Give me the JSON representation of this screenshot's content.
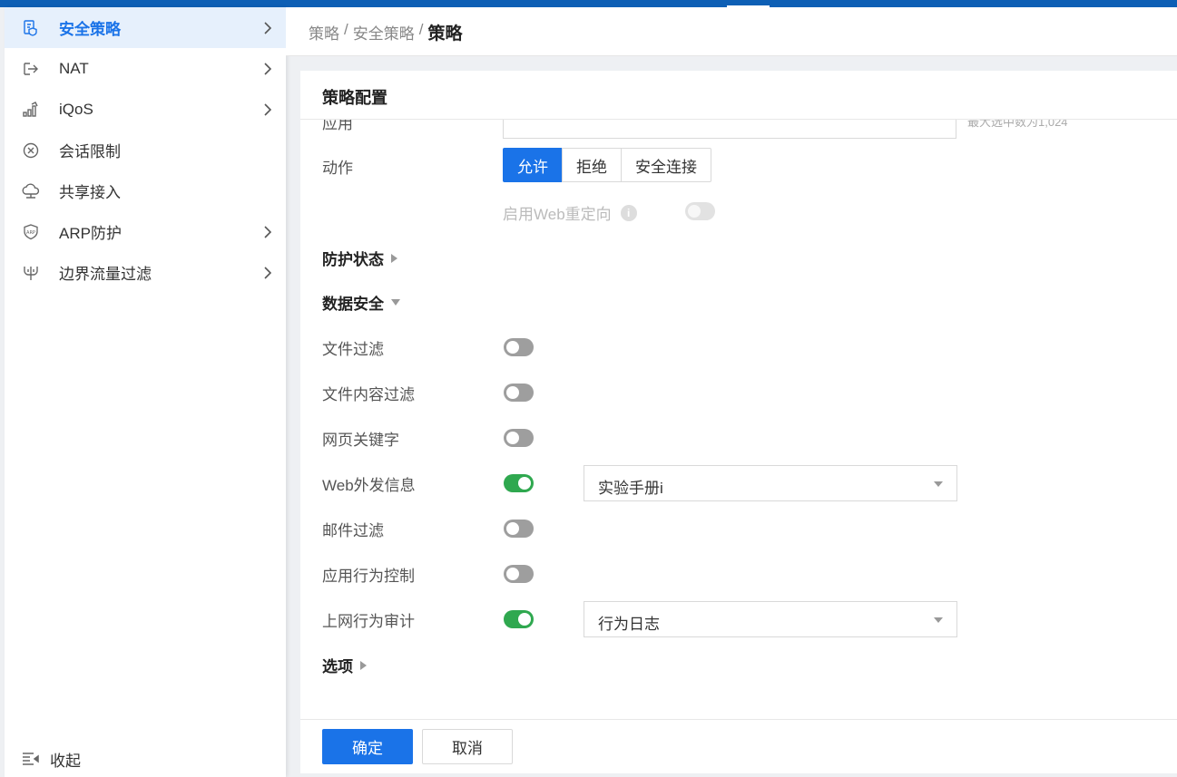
{
  "sidebar": {
    "items": [
      {
        "label": "安全策略",
        "icon": "policy-icon",
        "active": true,
        "has_children": true
      },
      {
        "label": "NAT",
        "icon": "nat-icon",
        "active": false,
        "has_children": true
      },
      {
        "label": "iQoS",
        "icon": "qos-chart-icon",
        "active": false,
        "has_children": true
      },
      {
        "label": "会话限制",
        "icon": "session-limit-icon",
        "active": false,
        "has_children": false
      },
      {
        "label": "共享接入",
        "icon": "shared-access-cloud-icon",
        "active": false,
        "has_children": false
      },
      {
        "label": "ARP防护",
        "icon": "arp-shield-icon",
        "active": false,
        "has_children": true
      },
      {
        "label": "边界流量过滤",
        "icon": "traffic-filter-icon",
        "active": false,
        "has_children": true
      }
    ],
    "collapse_label": "收起"
  },
  "breadcrumb": {
    "items": [
      "策略",
      "安全策略"
    ],
    "separator": "/",
    "current": "策略"
  },
  "panel": {
    "title": "策略配置",
    "application": {
      "label": "应用",
      "hint": "最大选中数为1,024"
    },
    "action": {
      "label": "动作",
      "options": [
        "允许",
        "拒绝",
        "安全连接"
      ],
      "selected": "允许"
    },
    "web_redirect": {
      "label": "启用Web重定向",
      "enabled": false,
      "disabled": true
    },
    "protection_status": {
      "label": "防护状态",
      "expanded": false
    },
    "data_security": {
      "label": "数据安全",
      "expanded": true,
      "rows": [
        {
          "label": "文件过滤",
          "on": false
        },
        {
          "label": "文件内容过滤",
          "on": false
        },
        {
          "label": "网页关键字",
          "on": false
        },
        {
          "label": "Web外发信息",
          "on": true,
          "select_value": "实验手册i"
        },
        {
          "label": "邮件过滤",
          "on": false
        },
        {
          "label": "应用行为控制",
          "on": false
        },
        {
          "label": "上网行为审计",
          "on": true,
          "select_value": "行为日志"
        }
      ]
    },
    "options": {
      "label": "选项",
      "expanded": false
    }
  },
  "footer": {
    "confirm_label": "确定",
    "cancel_label": "取消"
  },
  "colors": {
    "accent": "#1a73e8",
    "topbar": "#0d5fb5",
    "toggle_on": "#2fa84f",
    "toggle_off": "#9e9e9e"
  }
}
